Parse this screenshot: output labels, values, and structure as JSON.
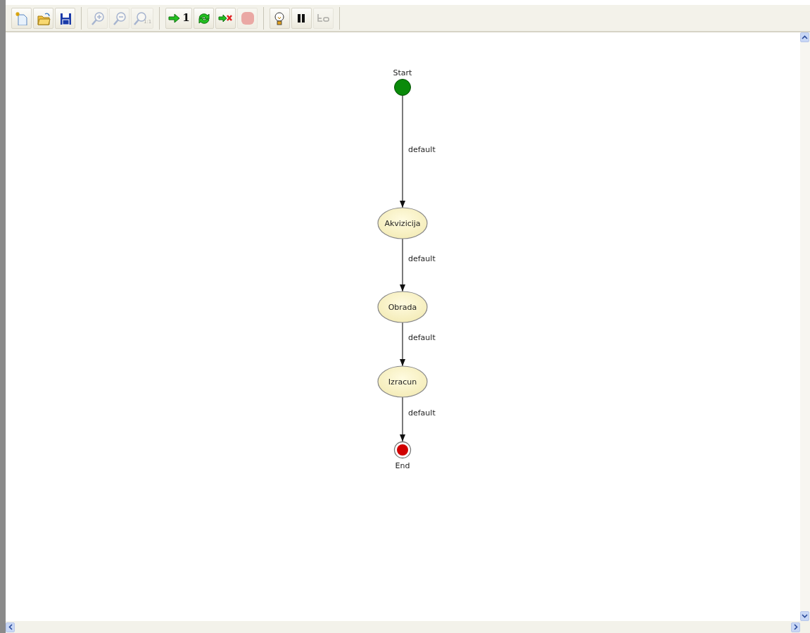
{
  "toolbar": {
    "groups": [
      [
        {
          "kind": "new",
          "disabled": false
        },
        {
          "kind": "open",
          "disabled": false
        },
        {
          "kind": "save",
          "disabled": false
        }
      ],
      [
        {
          "kind": "zoom-in",
          "disabled": true
        },
        {
          "kind": "zoom-out",
          "disabled": true
        },
        {
          "kind": "zoom-actual",
          "disabled": true,
          "label": "1:1"
        }
      ],
      [
        {
          "kind": "step",
          "disabled": false,
          "label": "1"
        },
        {
          "kind": "cycle",
          "disabled": false
        },
        {
          "kind": "stop-run",
          "disabled": false
        },
        {
          "kind": "stop",
          "disabled": true
        }
      ],
      [
        {
          "kind": "bulb",
          "disabled": false
        },
        {
          "kind": "pause",
          "disabled": false
        },
        {
          "kind": "trace",
          "disabled": true
        }
      ]
    ]
  },
  "diagram": {
    "nodes": [
      {
        "kind": "start",
        "label": "Start"
      },
      {
        "kind": "state",
        "label": "Akvizicija"
      },
      {
        "kind": "state",
        "label": "Obrada"
      },
      {
        "kind": "state",
        "label": "Izracun"
      },
      {
        "kind": "end",
        "label": "End"
      }
    ],
    "edges": [
      {
        "label": "default"
      },
      {
        "label": "default"
      },
      {
        "label": "default"
      },
      {
        "label": "default"
      }
    ]
  }
}
